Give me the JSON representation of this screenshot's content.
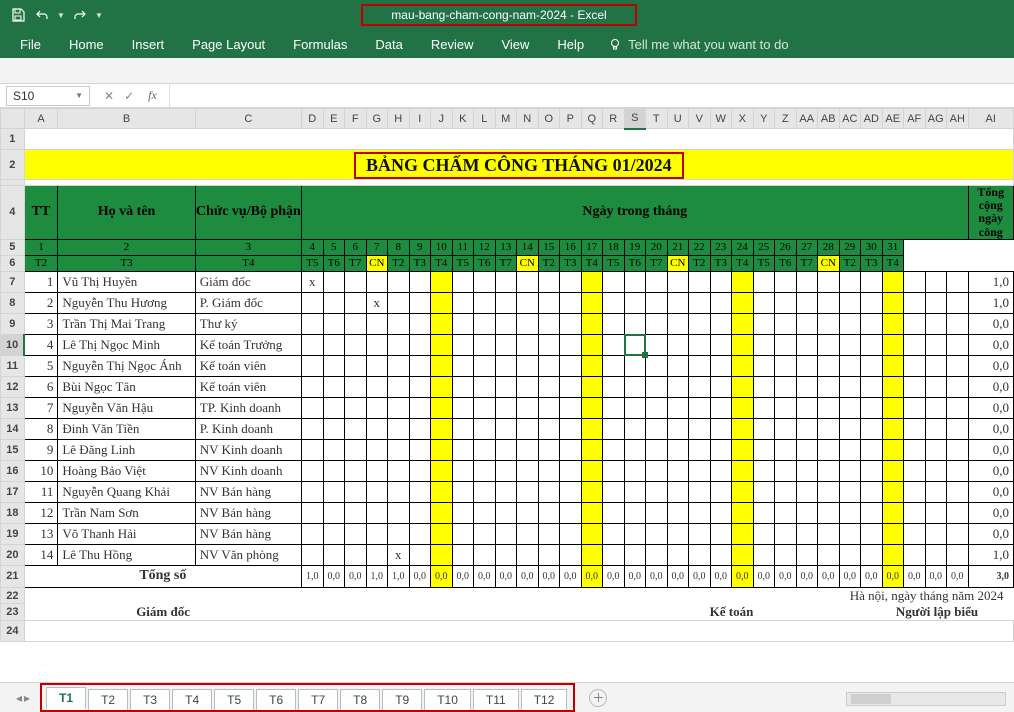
{
  "app": {
    "title": "mau-bang-cham-cong-nam-2024  -  Excel"
  },
  "ribbon": {
    "tabs": [
      "File",
      "Home",
      "Insert",
      "Page Layout",
      "Formulas",
      "Data",
      "Review",
      "View",
      "Help"
    ],
    "tell": "Tell me what you want to do"
  },
  "namebox": "S10",
  "col_headers": [
    "A",
    "B",
    "C",
    "D",
    "E",
    "F",
    "G",
    "H",
    "I",
    "J",
    "K",
    "L",
    "M",
    "N",
    "O",
    "P",
    "Q",
    "R",
    "S",
    "T",
    "U",
    "V",
    "W",
    "X",
    "Y",
    "Z",
    "AA",
    "AB",
    "AC",
    "AD",
    "AE",
    "AF",
    "AG",
    "AH",
    "AI"
  ],
  "selected_col_index": 18,
  "row_numbers": [
    1,
    2,
    4,
    5,
    6,
    7,
    8,
    9,
    10,
    11,
    12,
    13,
    14,
    15,
    16,
    17,
    18,
    19,
    20,
    21,
    22,
    23,
    24
  ],
  "selected_row_index": 7,
  "title_text": "BẢNG CHẤM CÔNG THÁNG 01/2024",
  "hdr": {
    "tt": "TT",
    "hoten": "Họ và tên",
    "chucvu": "Chức vụ/Bộ phận",
    "ngay": "Ngày trong tháng",
    "tong": "Tổng cộng ngày công"
  },
  "days": [
    "1",
    "2",
    "3",
    "4",
    "5",
    "6",
    "7",
    "8",
    "9",
    "10",
    "11",
    "12",
    "13",
    "14",
    "15",
    "16",
    "17",
    "18",
    "19",
    "20",
    "21",
    "22",
    "23",
    "24",
    "25",
    "26",
    "27",
    "28",
    "29",
    "30",
    "31"
  ],
  "daytypes": [
    "T2",
    "T3",
    "T4",
    "T5",
    "T6",
    "T7",
    "CN",
    "T2",
    "T3",
    "T4",
    "T5",
    "T6",
    "T7",
    "CN",
    "T2",
    "T3",
    "T4",
    "T5",
    "T6",
    "T7",
    "CN",
    "T2",
    "T3",
    "T4",
    "T5",
    "T6",
    "T7",
    "CN",
    "T2",
    "T3",
    "T4"
  ],
  "yellow_days": [
    6,
    13,
    20,
    27
  ],
  "rows": [
    {
      "tt": "1",
      "name": "Vũ Thị Huyền",
      "role": "Giám đốc",
      "marks": {
        "0": "x"
      },
      "tot": "1,0"
    },
    {
      "tt": "2",
      "name": "Nguyễn Thu Hương",
      "role": "P. Giám đốc",
      "marks": {
        "3": "x"
      },
      "tot": "1,0"
    },
    {
      "tt": "3",
      "name": "Trần Thị Mai Trang",
      "role": "Thư ký",
      "marks": {},
      "tot": "0,0"
    },
    {
      "tt": "4",
      "name": "Lê Thị Ngọc Minh",
      "role": "Kế toán Trưởng",
      "marks": {},
      "tot": "0,0"
    },
    {
      "tt": "5",
      "name": "Nguyễn Thị Ngọc Ánh",
      "role": "Kế toán viên",
      "marks": {},
      "tot": "0,0"
    },
    {
      "tt": "6",
      "name": "Bùi Ngọc Tân",
      "role": "Kế toán viên",
      "marks": {},
      "tot": "0,0"
    },
    {
      "tt": "7",
      "name": "Nguyễn Văn Hậu",
      "role": "TP. Kinh doanh",
      "marks": {},
      "tot": "0,0"
    },
    {
      "tt": "8",
      "name": "Đinh Văn Tiền",
      "role": "P. Kinh doanh",
      "marks": {},
      "tot": "0,0"
    },
    {
      "tt": "9",
      "name": "Lê Đăng Linh",
      "role": "NV Kinh doanh",
      "marks": {},
      "tot": "0,0"
    },
    {
      "tt": "10",
      "name": "Hoàng Bảo Việt",
      "role": "NV Kinh doanh",
      "marks": {},
      "tot": "0,0"
    },
    {
      "tt": "11",
      "name": "Nguyễn Quang Khải",
      "role": "NV Bán hàng",
      "marks": {},
      "tot": "0,0"
    },
    {
      "tt": "12",
      "name": "Trần Nam Sơn",
      "role": "NV Bán hàng",
      "marks": {},
      "tot": "0,0"
    },
    {
      "tt": "13",
      "name": "Võ Thanh Hải",
      "role": "NV Bán hàng",
      "marks": {},
      "tot": "0,0"
    },
    {
      "tt": "14",
      "name": "Lê Thu Hồng",
      "role": "NV Văn phòng",
      "marks": {
        "4": "x"
      },
      "tot": "1,0"
    }
  ],
  "totals": {
    "label": "Tổng số",
    "vals": [
      "1,0",
      "0,0",
      "0,0",
      "1,0",
      "1,0",
      "0,0",
      "0,0",
      "0,0",
      "0,0",
      "0,0",
      "0,0",
      "0,0",
      "0,0",
      "0,0",
      "0,0",
      "0,0",
      "0,0",
      "0,0",
      "0,0",
      "0,0",
      "0,0",
      "0,0",
      "0,0",
      "0,0",
      "0,0",
      "0,0",
      "0,0",
      "0,0",
      "0,0",
      "0,0",
      "0,0"
    ],
    "grand": "3,0"
  },
  "sig": {
    "date": "Hà nội, ngày       tháng      năm 2024",
    "a": "Giám đốc",
    "b": "Kế toán",
    "c": "Người lập biểu"
  },
  "sheet_tabs": [
    "T1",
    "T2",
    "T3",
    "T4",
    "T5",
    "T6",
    "T7",
    "T8",
    "T9",
    "T10",
    "T11",
    "T12"
  ],
  "active_sheet": 0
}
